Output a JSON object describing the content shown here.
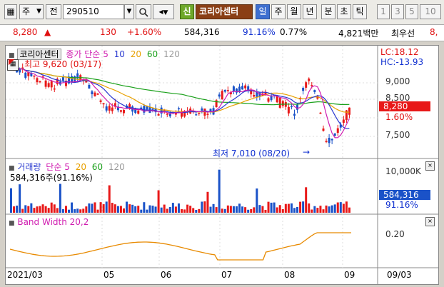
{
  "toolbar": {
    "market": "주",
    "period": "전",
    "code": "290510",
    "shin": "신",
    "name": "코리아센터",
    "periods": [
      "일",
      "주",
      "월",
      "년",
      "분",
      "초",
      "틱"
    ],
    "numbers": [
      "1",
      "3",
      "5",
      "10"
    ]
  },
  "price": {
    "current": "8,280",
    "change_sign": "▲",
    "change": "130",
    "change_pct": "+1.60%",
    "volume": "584,316",
    "vol_ratio": "91.16%",
    "turnover_pct": "0.77%",
    "amount": "4,821백만",
    "broker": "최우선",
    "extra": "8,"
  },
  "price_panel": {
    "title": "코리아센터",
    "ma_label": "종가 단순",
    "ma_periods": [
      "5",
      "10",
      "20",
      "60",
      "120"
    ],
    "ma_colors": [
      "#d01cb0",
      "#2a3ad0",
      "#e8a000",
      "#1aa01a",
      "#9a9a9a"
    ],
    "high_note": "최고 9,620 (03/17)",
    "low_note": "최저 7,010 (08/20)",
    "lc": "LC:18.12",
    "hc": "HC:-13.93",
    "ticks": [
      "9,000",
      "8,500",
      "8,000",
      "7,500"
    ],
    "current_tag": "8,280",
    "pct_tag": "1.60%"
  },
  "volume_panel": {
    "title": "거래량",
    "ma_label": "단순",
    "ma_periods": [
      "5",
      "20",
      "60",
      "120"
    ],
    "value_label": "584,316주(91.16%)",
    "tick": "10,000K",
    "current_tag": "584,316",
    "pct_tag": "91.16%"
  },
  "bw_panel": {
    "title": "Band Width 20,2",
    "tick": "0.20"
  },
  "x_axis": [
    "2021/03",
    "05",
    "06",
    "07",
    "08",
    "09",
    "09/03"
  ]
}
